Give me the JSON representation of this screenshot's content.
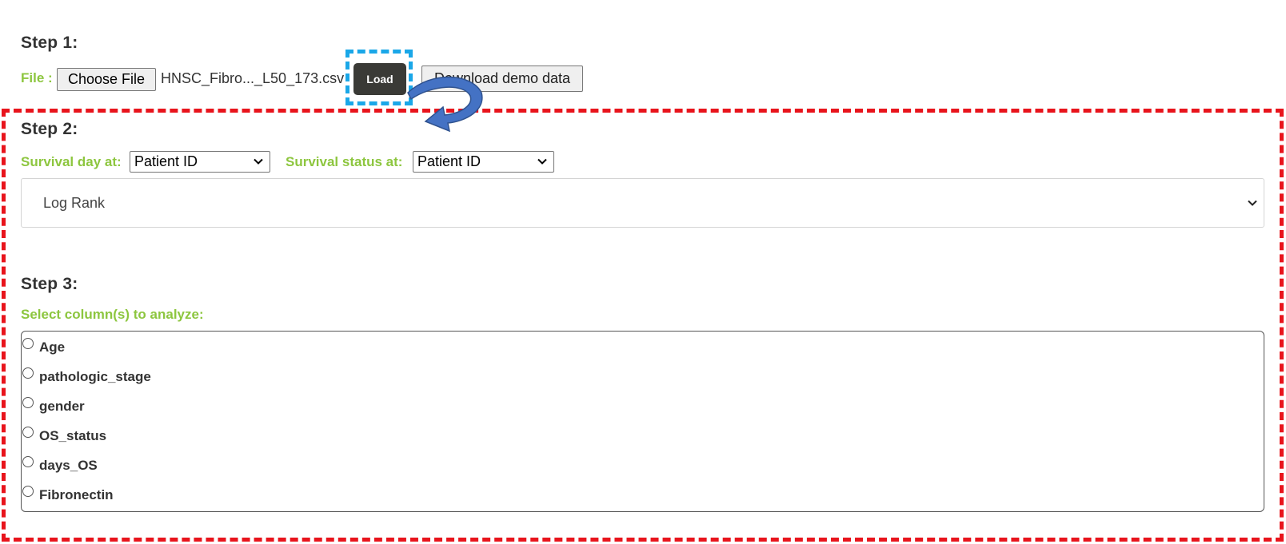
{
  "step1": {
    "heading": "Step 1:",
    "file_label": "File :",
    "choose_file_label": "Choose File",
    "file_name": "HNSC_Fibro..._L50_173.csv",
    "load_label": "Load",
    "download_demo_label": "Download demo data"
  },
  "step2": {
    "heading": "Step 2:",
    "survival_day_label": "Survival day at:",
    "survival_day_value": "Patient ID",
    "survival_status_label": "Survival status at:",
    "survival_status_value": "Patient ID",
    "test_method_value": "Log Rank"
  },
  "step3": {
    "heading": "Step 3:",
    "select_columns_label": "Select column(s) to analyze:",
    "columns": [
      "Age",
      "pathologic_stage",
      "gender",
      "OS_status",
      "days_OS",
      "Fibronectin"
    ]
  },
  "colors": {
    "label_green": "#8dc63f",
    "load_button": "#3a3a36",
    "highlight_blue": "#1aa7e8",
    "frame_red": "#e8141c",
    "arrow_blue": "#4472c4"
  },
  "icons": {
    "select_chevron": "chevron-down-icon",
    "annotation_arrow": "curved-arrow-icon"
  }
}
